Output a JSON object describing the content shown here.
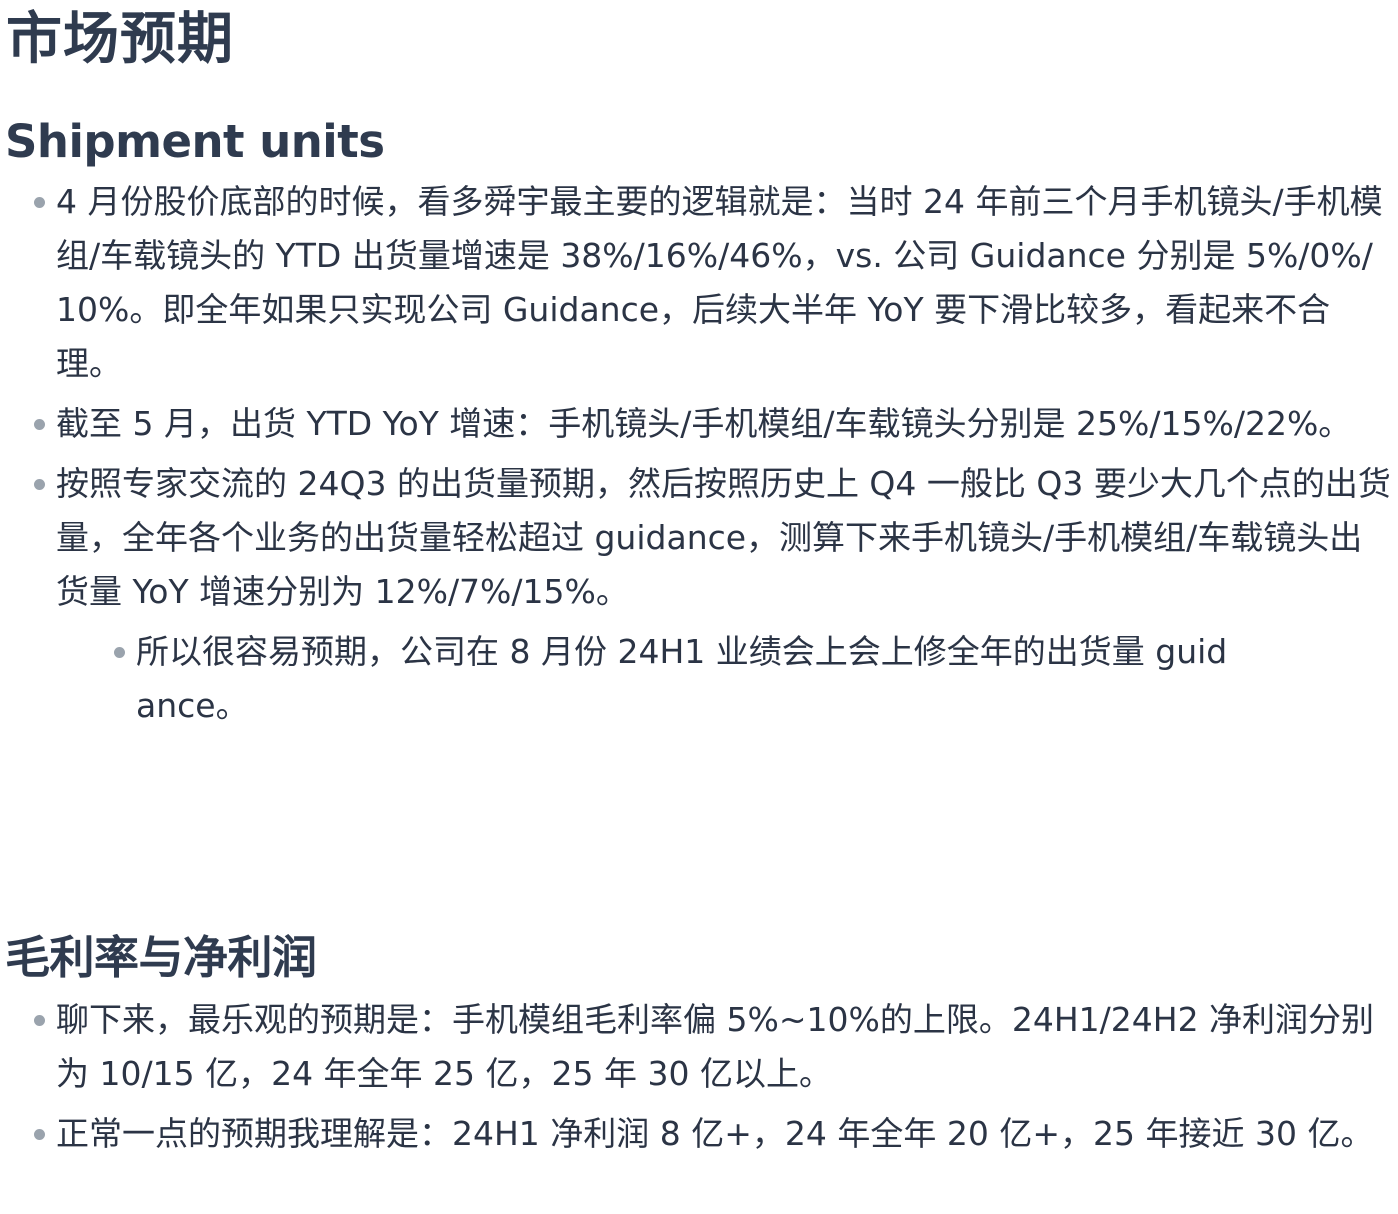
{
  "title": "市场预期",
  "sections": {
    "shipment": {
      "heading": "Shipment units",
      "items": [
        "4 月份股价底部的时候，看多舜宇最主要的逻辑就是：当时 24 年前三个月手机镜头/手机模组/车载镜头的 YTD 出货量增速是 38%/16%/46%，vs. 公司 Guidance 分别是 5%/0%/10%。即全年如果只实现公司 Guidance，后续大半年 YoY 要下滑比较多，看起来不合理。",
        "截至 5 月，出货 YTD YoY 增速：手机镜头/手机模组/车载镜头分别是 25%/15%/22%。",
        "按照专家交流的 24Q3 的出货量预期，然后按照历史上 Q4 一般比 Q3 要少大几个点的出货量，全年各个业务的出货量轻松超过 guidance，测算下来手机镜头/手机模组/车载镜头出货量 YoY 增速分别为 12%/7%/15%。"
      ],
      "sub_items": [
        "所以很容易预期，公司在 8 月份 24H1 业绩会上会上修全年的出货量 guidance。"
      ]
    },
    "margin": {
      "heading": "毛利率与净利润",
      "items": [
        "聊下来，最乐观的预期是：手机模组毛利率偏 5%~10%的上限。24H1/24H2 净利润分别为 10/15 亿，24 年全年 25 亿，25 年 30 亿以上。",
        "正常一点的预期我理解是：24H1 净利润 8 亿+，24 年全年 20 亿+，25 年接近 30 亿。"
      ]
    }
  }
}
